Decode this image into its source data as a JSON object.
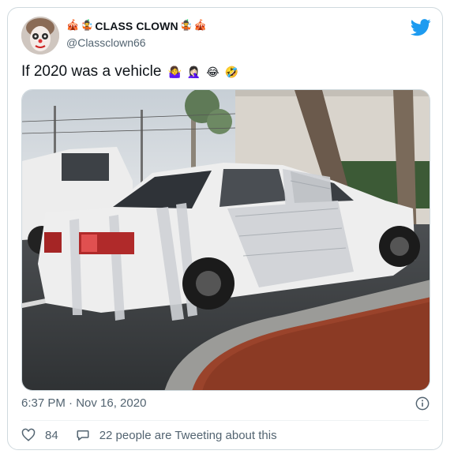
{
  "user": {
    "display_name": "CLASS CLOWN",
    "handle": "@Classclown66",
    "name_emojis_left": [
      "🎪",
      "🤹"
    ],
    "name_emojis_right": [
      "🤹",
      "🎪"
    ]
  },
  "tweet": {
    "text": "If 2020 was a vehicle",
    "emojis": [
      "🤷‍♀️",
      "🤦🏻‍♀️",
      "😂",
      "🤣"
    ]
  },
  "meta": {
    "timestamp": "6:37 PM · Nov 16, 2020"
  },
  "actions": {
    "likes": "84",
    "conversation": "22 people are Tweeting about this"
  },
  "colors": {
    "twitter_blue": "#1d9bf0",
    "secondary_text": "#536471",
    "border": "#cfd9de"
  },
  "icons": {
    "brand": "twitter-bird-icon",
    "info": "info-icon",
    "like": "heart-icon",
    "reply": "speech-bubble-icon"
  }
}
